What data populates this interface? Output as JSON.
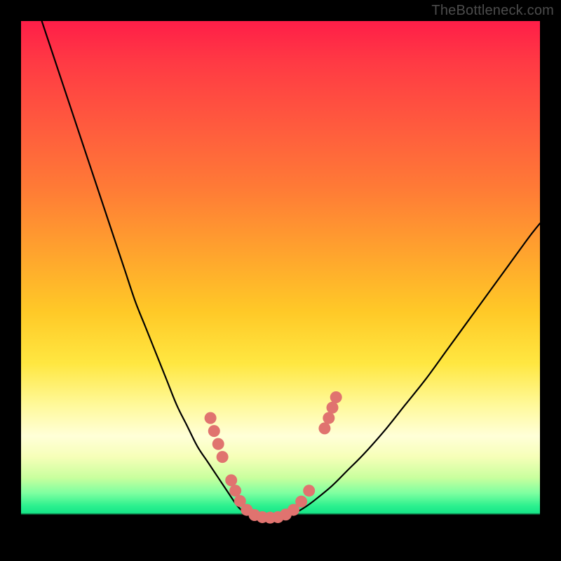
{
  "watermark": "TheBottleneck.com",
  "colors": {
    "curve_stroke": "#000000",
    "marker_fill": "#e0736f",
    "marker_stroke": "#c95a56"
  },
  "chart_data": {
    "type": "line",
    "title": "",
    "xlabel": "",
    "ylabel": "",
    "xlim": [
      0,
      100
    ],
    "ylim": [
      0,
      100
    ],
    "series": [
      {
        "name": "left-curve",
        "x": [
          4,
          6,
          8,
          10,
          12,
          14,
          16,
          18,
          20,
          22,
          24,
          26,
          28,
          30,
          32,
          34,
          36,
          38,
          40,
          41,
          42,
          43,
          44,
          45
        ],
        "y": [
          100,
          94,
          88,
          82,
          76,
          70,
          64,
          58,
          52,
          46,
          41,
          36,
          31,
          26,
          22,
          18,
          15,
          12,
          9,
          7.5,
          6.2,
          5.3,
          4.7,
          4.4
        ]
      },
      {
        "name": "valley-floor",
        "x": [
          45,
          46,
          47,
          48,
          49,
          50,
          51
        ],
        "y": [
          4.4,
          4.3,
          4.2,
          4.2,
          4.25,
          4.35,
          4.5
        ]
      },
      {
        "name": "right-curve",
        "x": [
          51,
          53,
          55,
          57,
          60,
          63,
          66,
          70,
          74,
          78,
          82,
          86,
          90,
          94,
          98,
          100
        ],
        "y": [
          4.5,
          5.3,
          6.5,
          8.0,
          10.5,
          13.5,
          16.5,
          21,
          26,
          31,
          36.5,
          42,
          47.5,
          53,
          58.5,
          61
        ]
      }
    ],
    "markers": [
      {
        "x": 36.5,
        "y": 23.5
      },
      {
        "x": 37.2,
        "y": 21.0
      },
      {
        "x": 38.0,
        "y": 18.5
      },
      {
        "x": 38.8,
        "y": 16.0
      },
      {
        "x": 40.5,
        "y": 11.5
      },
      {
        "x": 41.3,
        "y": 9.5
      },
      {
        "x": 42.2,
        "y": 7.5
      },
      {
        "x": 43.5,
        "y": 5.8
      },
      {
        "x": 45.0,
        "y": 4.8
      },
      {
        "x": 46.5,
        "y": 4.4
      },
      {
        "x": 48.0,
        "y": 4.3
      },
      {
        "x": 49.5,
        "y": 4.4
      },
      {
        "x": 51.0,
        "y": 4.9
      },
      {
        "x": 52.5,
        "y": 5.8
      },
      {
        "x": 54.0,
        "y": 7.4
      },
      {
        "x": 55.5,
        "y": 9.5
      },
      {
        "x": 58.5,
        "y": 21.5
      },
      {
        "x": 59.3,
        "y": 23.5
      },
      {
        "x": 60.0,
        "y": 25.5
      },
      {
        "x": 60.7,
        "y": 27.5
      }
    ]
  }
}
